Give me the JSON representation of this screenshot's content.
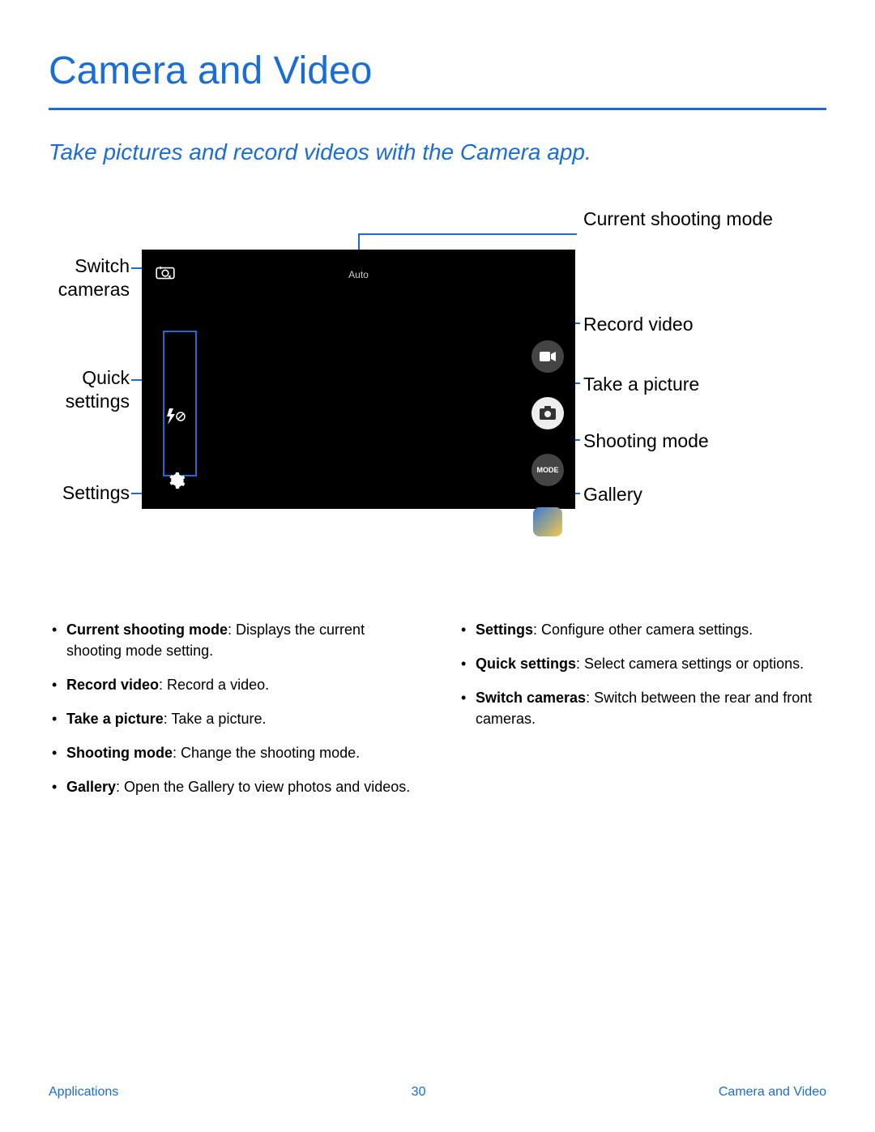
{
  "title": "Camera and Video",
  "subtitle": "Take pictures and record videos with the Camera app.",
  "screenshot": {
    "auto_label": "Auto",
    "mode_label": "MODE"
  },
  "callouts": {
    "switch_cameras": "Switch cameras",
    "quick_settings": "Quick settings",
    "settings": "Settings",
    "current_mode": "Current shooting mode",
    "record_video": "Record video",
    "take_picture": "Take a picture",
    "shooting_mode": "Shooting mode",
    "gallery": "Gallery"
  },
  "descriptions": {
    "left": [
      {
        "term": "Current shooting mode",
        "def": ": Displays the current shooting mode setting."
      },
      {
        "term": "Record video",
        "def": ": Record a video."
      },
      {
        "term": "Take a picture",
        "def": ": Take a picture."
      },
      {
        "term": "Shooting mode",
        "def": ": Change the shooting mode."
      },
      {
        "term": "Gallery",
        "def": ": Open the Gallery to view photos and videos."
      }
    ],
    "right": [
      {
        "term": "Settings",
        "def": ": Configure other camera settings."
      },
      {
        "term": "Quick settings",
        "def": ": Select camera settings or options."
      },
      {
        "term": "Switch cameras",
        "def": ": Switch between the rear and front cameras."
      }
    ]
  },
  "footer": {
    "left": "Applications",
    "center": "30",
    "right": "Camera and Video"
  }
}
